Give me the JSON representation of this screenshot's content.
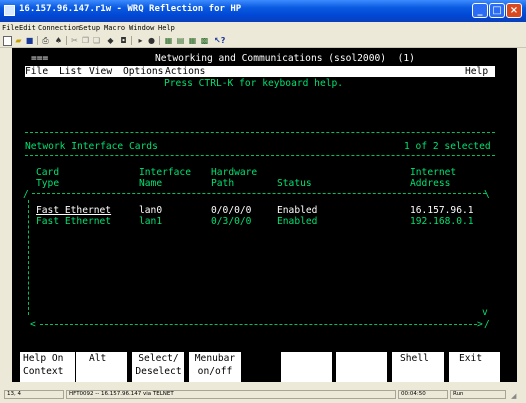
{
  "window": {
    "title": "16.157.96.147.r1w - WRQ Reflection for HP",
    "minimize": "_",
    "maximize": "□",
    "close": "×"
  },
  "menubar": [
    "File",
    "Edit",
    "Connection",
    "Setup",
    "Macro",
    "Window",
    "Help"
  ],
  "toolbar_icons": [
    "new-icon",
    "open-icon",
    "save-icon",
    "print-icon",
    "find-icon",
    "cut-icon",
    "copy-icon",
    "paste-icon",
    "transfer-icon",
    "transfer2-icon",
    "play-icon",
    "record-icon",
    "display-icon",
    "connect-icon",
    "keyboard-icon",
    "settings-icon",
    "whats-this-icon"
  ],
  "terminal": {
    "marker": "===",
    "header": "Networking and Communications (ssol2000)  (1)",
    "menu": {
      "file": "File",
      "list": "List",
      "view": "View",
      "options": "Options",
      "actions": "Actions",
      "help": "Help"
    },
    "hint": "Press CTRL-K for keyboard help.",
    "section_title": "Network Interface Cards",
    "selection_count": "1 of 2 selected",
    "columns": [
      [
        "Card",
        "Type"
      ],
      [
        "Interface",
        "Name"
      ],
      [
        "Hardware",
        "Path"
      ],
      [
        "",
        "Status"
      ],
      [
        "Internet",
        "Address"
      ]
    ],
    "rows": [
      {
        "card_type": "Fast Ethernet",
        "interface": "lan0",
        "path": "0/0/0/0",
        "status": "Enabled",
        "address": "16.157.96.1"
      },
      {
        "card_type": "Fast Ethernet",
        "interface": "lan1",
        "path": "0/3/0/0",
        "status": "Enabled",
        "address": "192.168.0.1"
      }
    ],
    "scroll_down": "v",
    "scroll_left": "<",
    "scroll_right": ">"
  },
  "function_keys": [
    {
      "top": "Help On",
      "bottom": "Context"
    },
    {
      "top": "Alt",
      "bottom": ""
    },
    {
      "top": "Select/",
      "bottom": "Deselect"
    },
    {
      "top": "Menubar",
      "bottom": "on/off"
    },
    {
      "top": "",
      "bottom": ""
    },
    {
      "top": "",
      "bottom": ""
    },
    {
      "top": "Shell",
      "bottom": ""
    },
    {
      "top": "Exit",
      "bottom": ""
    }
  ],
  "statusbar": {
    "cursor": "13, 4",
    "connection": "HFT0092 -- 16.157.96.147 via TELNET",
    "elapsed": "00:04:50",
    "run": "Run"
  }
}
